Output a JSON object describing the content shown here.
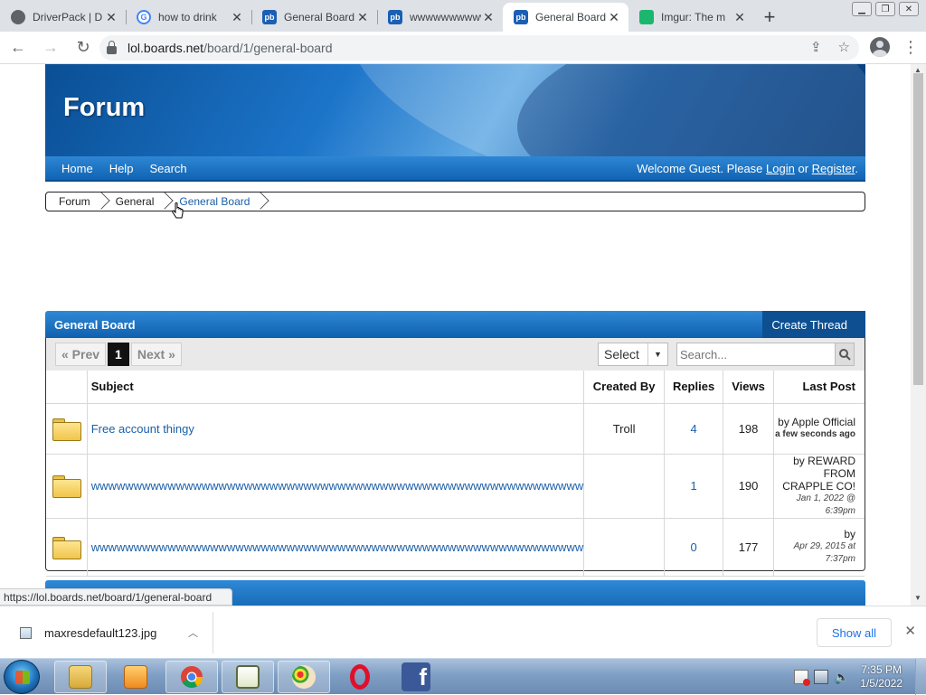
{
  "browser": {
    "tabs": [
      {
        "title": "DriverPack | D",
        "icon": "globe-icon"
      },
      {
        "title": "how to drink",
        "icon": "google-icon"
      },
      {
        "title": "General Board",
        "icon": "proboards-icon"
      },
      {
        "title": "wwwwwwwwww",
        "icon": "proboards-icon"
      },
      {
        "title": "General Board",
        "icon": "proboards-icon",
        "active": true
      },
      {
        "title": "Imgur: The m",
        "icon": "imgur-icon"
      }
    ],
    "close_glyph": "✕",
    "new_tab_glyph": "+",
    "url_host": "lol.boards.net",
    "url_path": "/board/1/general-board"
  },
  "forum": {
    "banner_title": "Forum",
    "nav": [
      "Home",
      "Help",
      "Search"
    ],
    "welcome_prefix": "Welcome Guest. Please",
    "login_label": "Login",
    "or_label": "or",
    "register_label": "Register",
    "welcome_suffix": ".",
    "breadcrumb": [
      "Forum",
      "General",
      "General Board"
    ]
  },
  "board": {
    "title": "General Board",
    "create_label": "Create Thread",
    "prev_label": "« Prev",
    "current_page": "1",
    "next_label": "Next »",
    "select_label": "Select",
    "search_placeholder": "Search...",
    "columns": {
      "subject": "Subject",
      "created_by": "Created By",
      "replies": "Replies",
      "views": "Views",
      "last_post": "Last Post"
    },
    "threads": [
      {
        "subject": "Free account thingy",
        "created_by": "Troll",
        "replies": "4",
        "views": "198",
        "last_by": "by Apple Official",
        "last_when": "a few seconds ago"
      },
      {
        "subject": "wwwwwwwwwwwwwwwwwwwwwwwwwwwwwwwwwwwwwwwwwwwwwwwwwwwwwwwwww",
        "created_by": "",
        "replies": "1",
        "views": "190",
        "last_by": "by REWARD FROM CRAPPLE CO!",
        "last_when": "Jan 1, 2022 @ 6:39pm"
      },
      {
        "subject": "wwwwwwwwwwwwwwwwwwwwwwwwwwwwwwwwwwwwwwwwwwwwwwwwwwwwwwwwww",
        "created_by": "",
        "replies": "0",
        "views": "177",
        "last_by": "by",
        "last_when": "Apr 29, 2015 at 7:37pm"
      }
    ]
  },
  "status_url": "https://lol.boards.net/board/1/general-board",
  "download": {
    "file_name": "maxresdefault123.jpg",
    "show_all_label": "Show all"
  },
  "taskbar": {
    "time": "7:35 PM",
    "date": "1/5/2022"
  },
  "colors": {
    "link_blue": "#1a5fa8",
    "forum_blue": "#1064b3",
    "chrome_blue": "#1a73e8"
  }
}
